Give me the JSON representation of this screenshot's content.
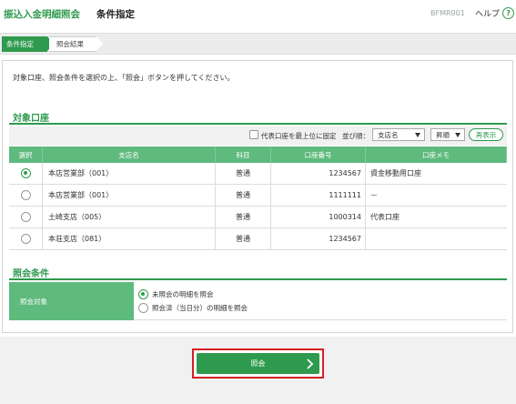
{
  "header": {
    "app_title": "振込入金明細照会",
    "screen_title": "条件指定",
    "screen_id": "BFMR001",
    "help_label": "ヘルプ",
    "help_icon": "help-icon",
    "help_icon_glyph": "?"
  },
  "steps": [
    {
      "label": "条件指定",
      "active": true
    },
    {
      "label": "照会結果",
      "active": false
    }
  ],
  "instruction": "対象口座、照会条件を選択の上、「照会」ボタンを押してください。",
  "accounts_section": {
    "title": "対象口座",
    "pin_label": "代表口座を最上位に固定",
    "pin_checked": false,
    "sort_label": "並び順：",
    "sort_field_value": "支店名",
    "sort_order_value": "昇順",
    "redisplay_label": "再表示",
    "table": {
      "headers": [
        "選択",
        "支店名",
        "科目",
        "口座番号",
        "口座メモ"
      ],
      "rows": [
        {
          "selected": true,
          "branch": "本店営業部（001）",
          "subject": "普通",
          "number": "1234567",
          "memo": "資金移動用口座"
        },
        {
          "selected": false,
          "branch": "本店営業部（001）",
          "subject": "普通",
          "number": "1111111",
          "memo": "－"
        },
        {
          "selected": false,
          "branch": "土崎支店（005）",
          "subject": "普通",
          "number": "1000314",
          "memo": "代表口座"
        },
        {
          "selected": false,
          "branch": "本荘支店（081）",
          "subject": "普通",
          "number": "1234567",
          "memo": ""
        }
      ]
    }
  },
  "conditions_section": {
    "title": "照会条件",
    "field_label": "照会対象",
    "options": [
      {
        "label": "未照会の明細を照会",
        "selected": true
      },
      {
        "label": "照会済（当日分）の明細を照会",
        "selected": false
      }
    ]
  },
  "actions": {
    "inquiry_label": "照会",
    "inquiry_icon": "chevron-right-icon"
  },
  "colors": {
    "brand_green": "#2e9a4e",
    "table_header_green": "#5fba7d",
    "highlight_red": "#d42020"
  }
}
